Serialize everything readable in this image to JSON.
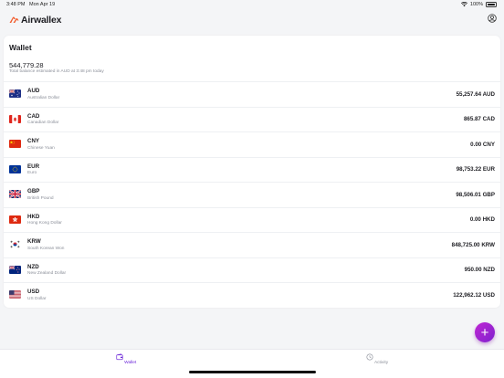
{
  "status_bar": {
    "time": "3:48 PM",
    "date": "Mon Apr 19",
    "battery": "100%"
  },
  "header": {
    "brand": "Airwallex"
  },
  "wallet": {
    "title": "Wallet",
    "total_balance": "544,779.28",
    "total_caption": "Total balance estimated in AUD at 3:48 pm today",
    "currencies": [
      {
        "code": "AUD",
        "name": "Australian Dollar",
        "amount": "55,257.64 AUD"
      },
      {
        "code": "CAD",
        "name": "Canadian Dollar",
        "amount": "865.87 CAD"
      },
      {
        "code": "CNY",
        "name": "Chinese Yuan",
        "amount": "0.00 CNY"
      },
      {
        "code": "EUR",
        "name": "Euro",
        "amount": "98,753.22 EUR"
      },
      {
        "code": "GBP",
        "name": "British Pound",
        "amount": "98,506.01 GBP"
      },
      {
        "code": "HKD",
        "name": "Hong Kong Dollar",
        "amount": "0.00 HKD"
      },
      {
        "code": "KRW",
        "name": "South Korean Won",
        "amount": "848,725.00 KRW"
      },
      {
        "code": "NZD",
        "name": "New Zealand Dollar",
        "amount": "950.00 NZD"
      },
      {
        "code": "USD",
        "name": "US Dollar",
        "amount": "122,962.12 USD"
      }
    ]
  },
  "fab": {
    "symbol": "+",
    "icon": "plus-icon"
  },
  "tabs": [
    {
      "label": "Wallet",
      "icon": "wallet-icon",
      "active": true
    },
    {
      "label": "Activity",
      "icon": "clock-icon",
      "active": false
    }
  ],
  "colors": {
    "accent": "#6d28d9",
    "fab_start": "#c026d3",
    "fab_end": "#7e22ce",
    "brand_orange": "#f25a2b"
  }
}
